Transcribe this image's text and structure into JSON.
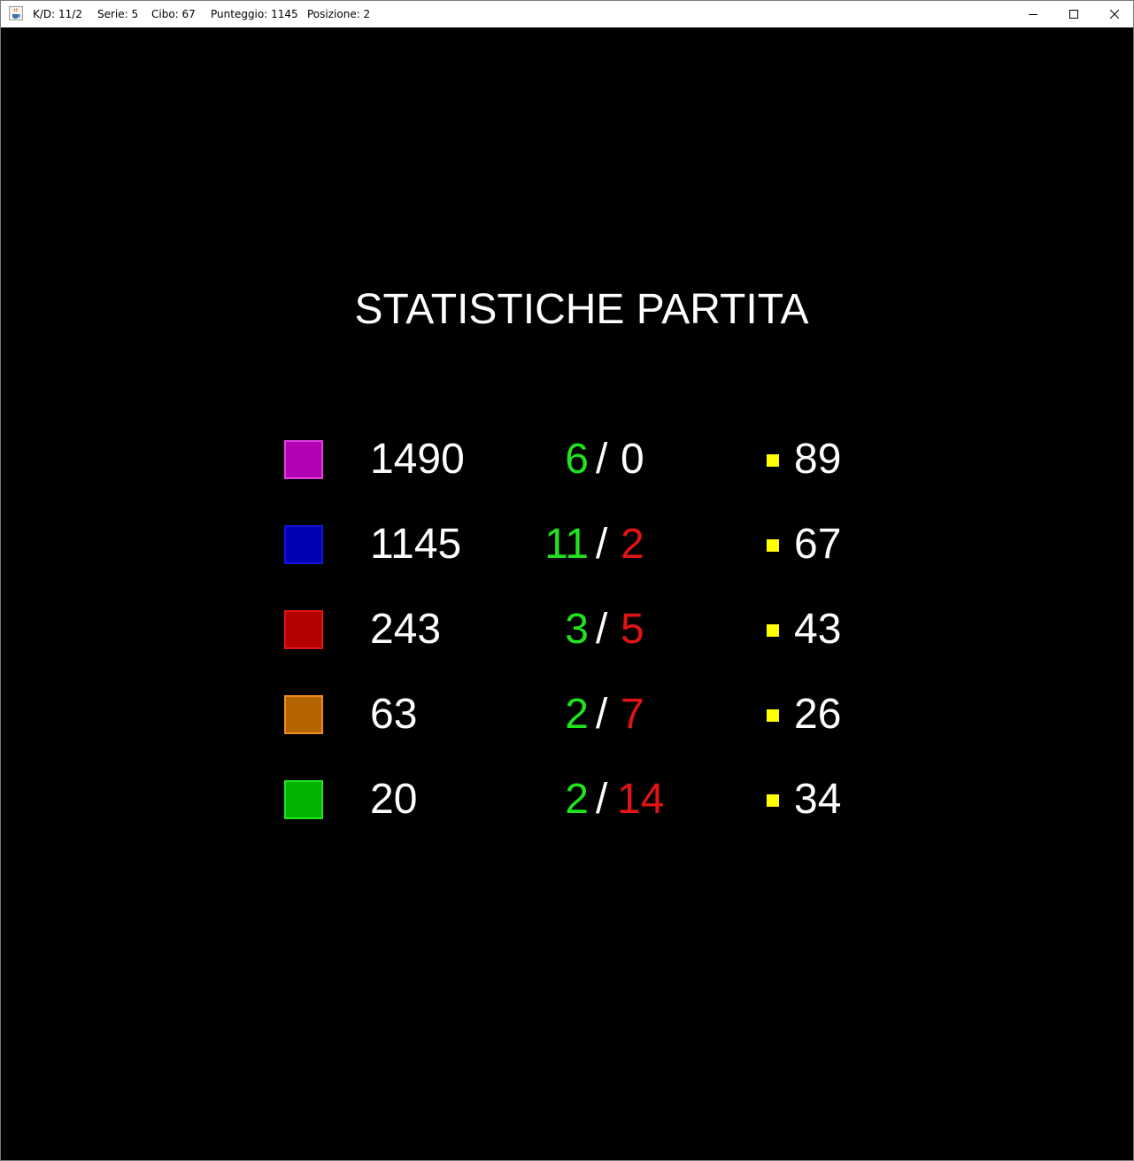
{
  "titlebar": {
    "kd": "K/D: 11/2",
    "serie": "Serie: 5",
    "cibo": "Cibo: 67",
    "punteggio": "Punteggio: 1145",
    "posizione": "Posizione: 2",
    "icon": "java-cup-icon"
  },
  "window_controls": [
    "minimize-icon",
    "maximize-icon",
    "close-icon"
  ],
  "heading": "STATISTICHE PARTITA",
  "colors": {
    "kills": "#1fe41f",
    "deaths_nonzero": "#e01414",
    "deaths_zero": "#ffffff",
    "food_icon": "#ffff00",
    "background": "#000000"
  },
  "players": [
    {
      "color": "#b400b4",
      "border": "#e040e0",
      "score": "1490",
      "kills": "6",
      "slash": "/",
      "deaths": "0",
      "food": "89"
    },
    {
      "color": "#0000b4",
      "border": "#1414d8",
      "score": "1145",
      "kills": "11",
      "slash": "/",
      "deaths": "2",
      "food": "67"
    },
    {
      "color": "#b40000",
      "border": "#e01414",
      "score": "243",
      "kills": "3",
      "slash": "/",
      "deaths": "5",
      "food": "43"
    },
    {
      "color": "#b46400",
      "border": "#f08c1e",
      "score": "63",
      "kills": "2",
      "slash": "/",
      "deaths": "7",
      "food": "26"
    },
    {
      "color": "#00b400",
      "border": "#1ee41e",
      "score": "20",
      "kills": "2",
      "slash": "/",
      "deaths": "14",
      "food": "34"
    }
  ]
}
